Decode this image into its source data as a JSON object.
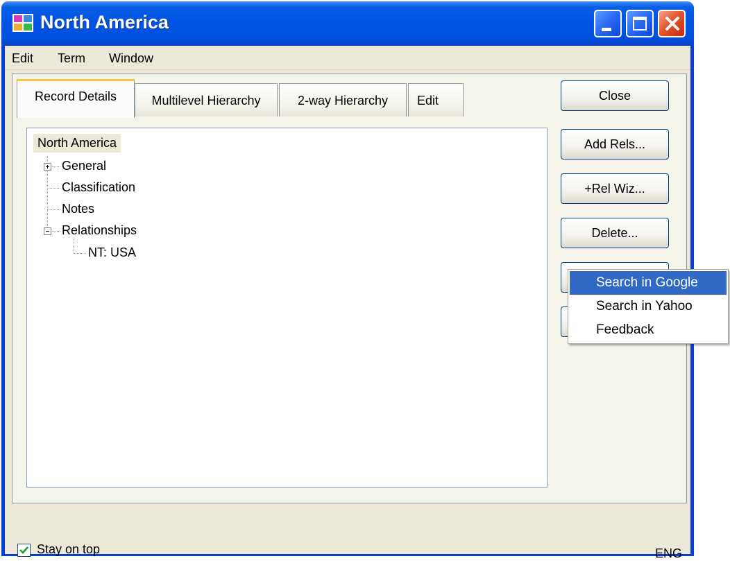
{
  "window": {
    "title": "North America",
    "buttons": [
      "minimize",
      "maximize",
      "close"
    ]
  },
  "menu": [
    "Edit",
    "Term",
    "Window"
  ],
  "tabs": [
    "Record Details",
    "Multilevel Hierarchy",
    "2-way Hierarchy",
    "Edit"
  ],
  "active_tab": "Record Details",
  "tree": {
    "root": "North America",
    "nodes": [
      {
        "label": "General",
        "expander": "plus"
      },
      {
        "label": "Classification"
      },
      {
        "label": "Notes"
      },
      {
        "label": "Relationships",
        "expander": "minus"
      }
    ],
    "child": "NT: USA"
  },
  "buttons": {
    "close": "Close",
    "add_rels": "Add Rels...",
    "rel_wiz": "+Rel Wiz...",
    "delete": "Delete..."
  },
  "context_menu": {
    "items": [
      "Search in Google",
      "Search in Yahoo",
      "Feedback"
    ],
    "highlighted": "Search in Google"
  },
  "footer": {
    "stay_on_top": "Stay on top",
    "stay_on_top_checked": true,
    "ime": "ENG"
  },
  "colors": {
    "titlebar": "#0054e3",
    "highlight": "#316ac5",
    "face": "#ece9d8",
    "checkmark": "#21a121"
  },
  "icons": [
    "app-grid-icon",
    "minimize-icon",
    "maximize-icon",
    "close-icon",
    "plus-expander-icon",
    "minus-expander-icon",
    "checkmark-icon"
  ]
}
